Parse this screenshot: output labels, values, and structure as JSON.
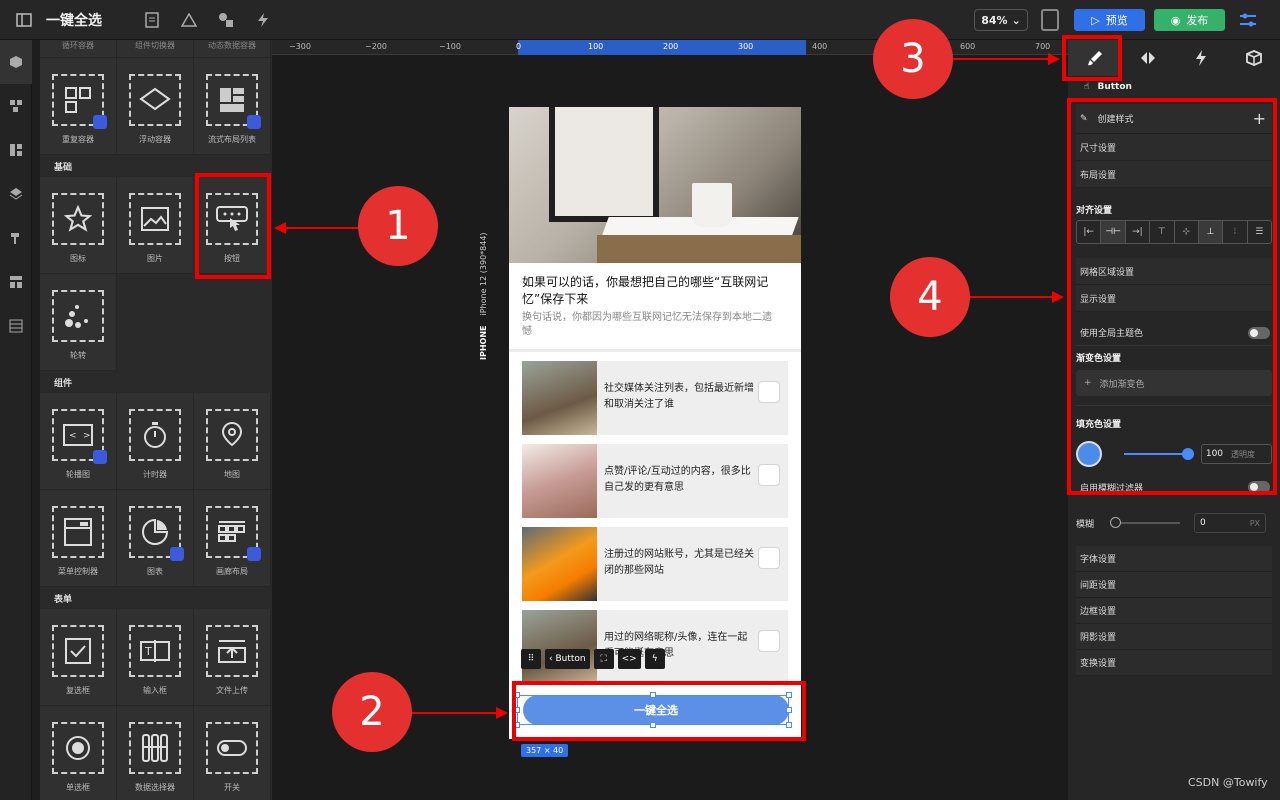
{
  "app": {
    "title": "一键全选",
    "zoom": "84%",
    "preview_label": "预览",
    "publish_label": "发布"
  },
  "components": {
    "top_partial": [
      "循环容器",
      "组件切换器",
      "动态数据容器"
    ],
    "row_containers": [
      "重复容器",
      "浮动容器",
      "流式布局列表"
    ],
    "section_basic": "基础",
    "basic_row1": [
      "图标",
      "图片",
      "按钮"
    ],
    "basic_row2": [
      "轮转"
    ],
    "section_components": "组件",
    "comp_row1": [
      "轮播图",
      "计时器",
      "地图"
    ],
    "comp_row2": [
      "菜单控制器",
      "图表",
      "画廊布局"
    ],
    "section_form": "表单",
    "form_row1": [
      "复选框",
      "输入框",
      "文件上传"
    ],
    "form_row2": [
      "单选框",
      "数据选择器",
      "开关"
    ]
  },
  "ruler": {
    "ticks": [
      "−300",
      "−200",
      "−100",
      "0",
      "100",
      "200",
      "300",
      "400",
      "600",
      "700"
    ]
  },
  "canvas": {
    "device_label": "IPHONE",
    "device_model": "iPhone 12 (390*844)",
    "article_title": "如果可以的话，你最想把自己的哪些“互联网记忆”保存下来",
    "article_sub": "换句话说，你都因为哪些互联网记忆无法保存到本地二遗憾",
    "items": [
      {
        "text": "社交媒体关注列表，包括最近新增和取消关注了谁"
      },
      {
        "text": "点赞/评论/互动过的内容，很多比自己发的更有意思"
      },
      {
        "text": "注册过的网站账号，尤其是已经关闭的那些网站"
      },
      {
        "text": "用过的网络昵称/头像，连在一起看可能挺有意思"
      }
    ],
    "toolbar_button_label": "Button",
    "main_button_label": "一键全选",
    "size_tag": "357 × 40"
  },
  "inspector": {
    "component_name": "Button",
    "create_style": "创建样式",
    "size_settings": "尺寸设置",
    "layout_settings": "布局设置",
    "align_settings": "对齐设置",
    "grid_settings": "网格区域设置",
    "display_settings": "显示设置",
    "global_theme": "使用全局主题色",
    "gradient_settings": "渐变色设置",
    "add_gradient": "添加渐变色",
    "fill_settings": "填充色设置",
    "opacity_value": "100",
    "opacity_label": "透明度",
    "blur_filter": "启用模糊过滤器",
    "blur_label": "模糊",
    "blur_value": "0",
    "blur_unit": "PX",
    "font_settings": "字体设置",
    "spacing_settings": "间距设置",
    "border_settings": "边框设置",
    "shadow_settings": "阴影设置",
    "transform_settings": "变换设置",
    "fill_color": "#4a8ce8"
  },
  "annotations": {
    "n1": "1",
    "n2": "2",
    "n3": "3",
    "n4": "4",
    "color": "#e00000"
  },
  "watermark": "CSDN @Towify"
}
